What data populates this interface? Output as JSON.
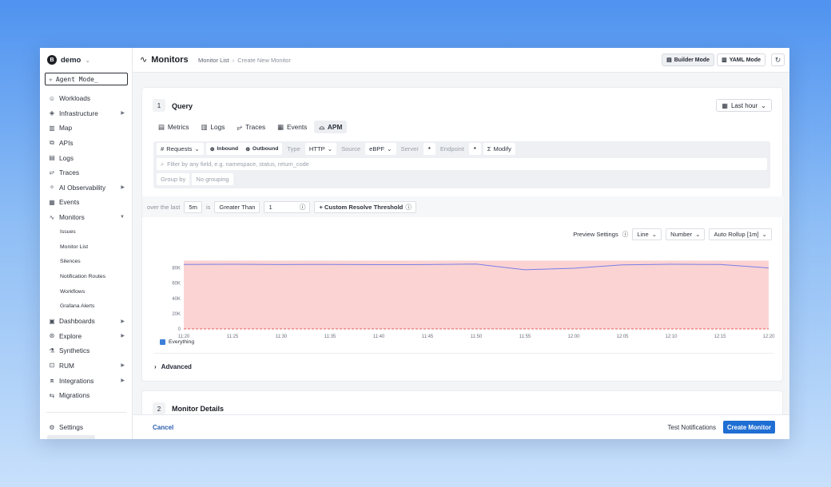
{
  "sidebar": {
    "org": {
      "logo": "B",
      "name": "demo"
    },
    "agent_mode": "Agent Mode_",
    "items": [
      {
        "label": "Workloads",
        "icon": "workloads-icon",
        "glyph": "☺",
        "caret": false,
        "sub": false
      },
      {
        "label": "Infrastructure",
        "icon": "infrastructure-icon",
        "glyph": "◈",
        "caret": true,
        "sub": false
      },
      {
        "label": "Map",
        "icon": "map-icon",
        "glyph": "▥",
        "caret": false,
        "sub": false
      },
      {
        "label": "APIs",
        "icon": "apis-icon",
        "glyph": "⧉",
        "caret": false,
        "sub": false
      },
      {
        "label": "Logs",
        "icon": "logs-icon",
        "glyph": "▤",
        "caret": false,
        "sub": false
      },
      {
        "label": "Traces",
        "icon": "traces-icon",
        "glyph": "⥂",
        "caret": false,
        "sub": false
      },
      {
        "label": "AI Observability",
        "icon": "ai-observability-icon",
        "glyph": "✧",
        "caret": true,
        "sub": false
      },
      {
        "label": "Events",
        "icon": "events-icon",
        "glyph": "▦",
        "caret": false,
        "sub": false
      },
      {
        "label": "Monitors",
        "icon": "monitors-icon",
        "glyph": "∿",
        "caret": true,
        "caret_down": true,
        "sub": false
      },
      {
        "label": "Issues",
        "sub": true
      },
      {
        "label": "Monitor List",
        "sub": true
      },
      {
        "label": "Silences",
        "sub": true
      },
      {
        "label": "Notification Routes",
        "sub": true
      },
      {
        "label": "Workflows",
        "sub": true
      },
      {
        "label": "Grafana Alerts",
        "sub": true
      },
      {
        "label": "Dashboards",
        "icon": "dashboards-icon",
        "glyph": "▣",
        "caret": true,
        "sub": false
      },
      {
        "label": "Explore",
        "icon": "explore-icon",
        "glyph": "⊛",
        "caret": true,
        "sub": false
      },
      {
        "label": "Synthetics",
        "icon": "synthetics-icon",
        "glyph": "⚗",
        "caret": false,
        "sub": false
      },
      {
        "label": "RUM",
        "icon": "rum-icon",
        "glyph": "⊡",
        "caret": true,
        "sub": false
      },
      {
        "label": "Integrations",
        "icon": "integrations-icon",
        "glyph": "⧈",
        "caret": true,
        "sub": false
      },
      {
        "label": "Migrations",
        "icon": "migrations-icon",
        "glyph": "⇆",
        "caret": false,
        "sub": false
      }
    ],
    "settings": {
      "label": "Settings",
      "icon": "settings-icon",
      "glyph": "⚙"
    }
  },
  "header": {
    "title": "Monitors",
    "breadcrumb": [
      "Monitor List",
      "Create New Monitor"
    ],
    "builder_mode": "Builder Mode",
    "yaml_mode": "YAML Mode"
  },
  "query": {
    "step": "1",
    "title": "Query",
    "time_range": "Last hour",
    "tabs": [
      {
        "label": "Metrics",
        "icon": "metrics-icon",
        "glyph": "▤",
        "active": false
      },
      {
        "label": "Logs",
        "icon": "logs-icon",
        "glyph": "▥",
        "active": false
      },
      {
        "label": "Traces",
        "icon": "traces-icon",
        "glyph": "⥂",
        "active": false
      },
      {
        "label": "Events",
        "icon": "events-icon",
        "glyph": "▦",
        "active": false
      },
      {
        "label": "APM",
        "icon": "apm-icon",
        "glyph": "⌓",
        "active": true
      }
    ],
    "metric": "Requests",
    "inbound": "Inbound",
    "outbound": "Outbound",
    "type_label": "Type",
    "type_value": "HTTP",
    "source_label": "Source",
    "source_value": "eBPF",
    "server_label": "Server",
    "server_value": "*",
    "endpoint_label": "Endpoint",
    "endpoint_value": "*",
    "modify": "Modify",
    "filter_placeholder": "Filter by any field, e.g. namespace, status, return_code",
    "group_by_label": "Group by",
    "group_by_value": "No grouping"
  },
  "threshold": {
    "over_the_last": "over the last",
    "window": "5m",
    "is": "is",
    "comparator": "Greater Than",
    "value": "1",
    "custom_resolve": "+ Custom Resolve Threshold"
  },
  "preview": {
    "label": "Preview Settings",
    "chart_type": "Line",
    "format": "Number",
    "rollup": "Auto Rollup [1m]"
  },
  "chart_data": {
    "type": "line",
    "x": [
      "11:20",
      "11:25",
      "11:30",
      "11:35",
      "11:40",
      "11:45",
      "11:50",
      "11:55",
      "12:00",
      "12:05",
      "12:10",
      "12:15",
      "12:20"
    ],
    "yticks": [
      "0",
      "20K",
      "40K",
      "60K",
      "80K"
    ],
    "ylim": [
      0,
      90000
    ],
    "threshold": 1,
    "series": [
      {
        "name": "Everything",
        "color": "#7a7ee6",
        "values": [
          84500,
          84800,
          84300,
          84600,
          84200,
          84400,
          85000,
          77500,
          79500,
          84000,
          84800,
          84500,
          80000
        ]
      }
    ],
    "fill_color": "#fbd3d3",
    "threshold_color": "#e85a5a"
  },
  "advanced": "Advanced",
  "details": {
    "step": "2",
    "title": "Monitor Details"
  },
  "footer": {
    "cancel": "Cancel",
    "test_notifications": "Test Notifications",
    "create": "Create Monitor"
  }
}
